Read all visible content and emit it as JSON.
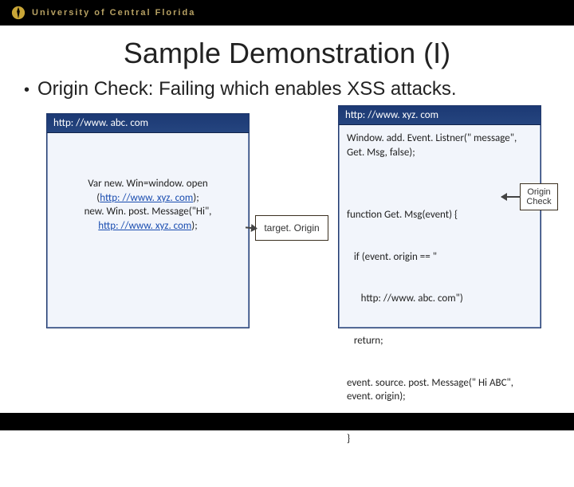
{
  "header": {
    "university": "University of Central Florida"
  },
  "title": "Sample Demonstration (I)",
  "bullet": "Origin Check: Failing which enables XSS attacks.",
  "left_browser": {
    "url": "http: //www. abc. com",
    "code_pre": "Var new. Win=window. open\n(",
    "code_link": "http: //www. xyz. com",
    "code_mid": ");\nnew. Win. post. Message(\"Hi\",\n",
    "code_link2": "http: //www. xyz. com",
    "code_post": ");"
  },
  "right_browser": {
    "url": "http: //www. xyz. com",
    "listener": "Window. add. Event. Listner(\" message\", Get. Msg, false);",
    "func_l1": "function Get. Msg(event) {",
    "func_l2": "   if (event. origin == \"",
    "func_l3": "      http: //www. abc. com\")",
    "func_l4": "   return;",
    "func_l5": "event. source. post. Message(\" Hi ABC\", event. origin);",
    "func_l6": "}"
  },
  "labels": {
    "target_origin": "target. Origin",
    "origin_check": "Origin Check"
  }
}
